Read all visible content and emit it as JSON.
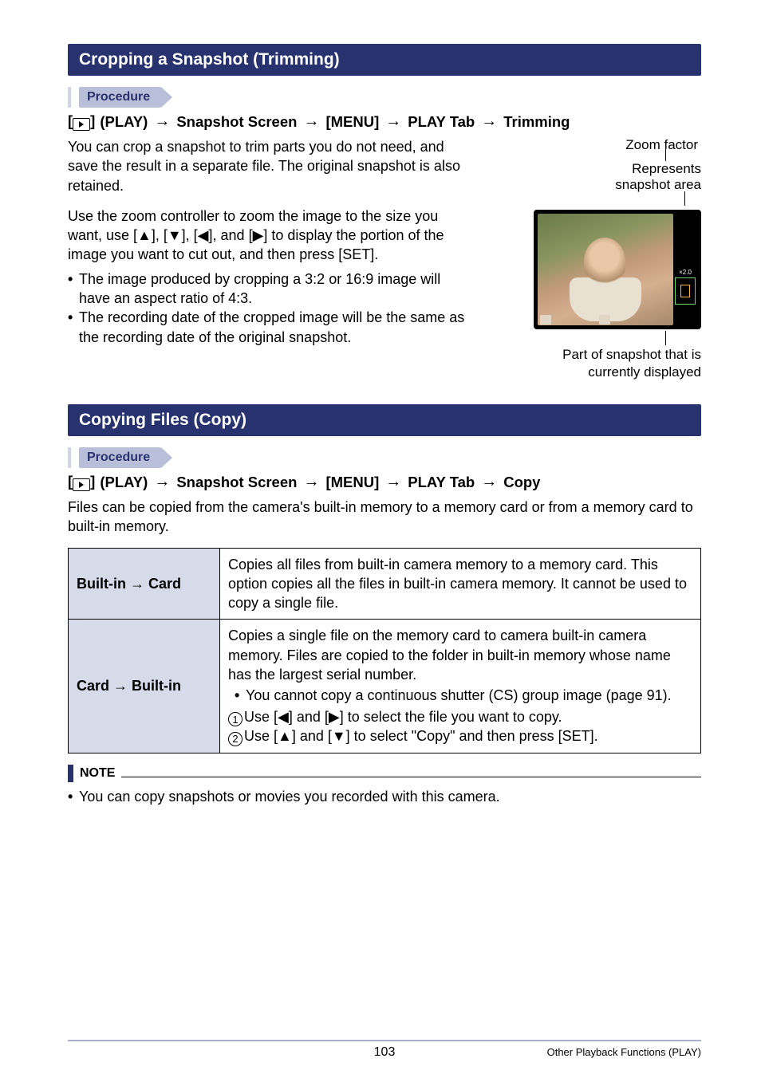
{
  "section1": {
    "title": "Cropping a Snapshot (Trimming)",
    "procedure_label": "Procedure",
    "breadcrumb": [
      "(PLAY)",
      "Snapshot Screen",
      "[MENU]",
      "PLAY Tab",
      "Trimming"
    ],
    "para1": "You can crop a snapshot to trim parts you do not need, and save the result in a separate file. The original snapshot is also retained.",
    "para2": "Use the zoom controller to zoom the image to the size you want, use [▲], [▼], [◀], and [▶] to display the portion of the image you want to cut out, and then press [SET].",
    "bullets": [
      "The image produced by cropping a 3:2 or 16:9 image will have an aspect ratio of 4:3.",
      "The recording date of the cropped image will be the same as the recording date of the original snapshot."
    ],
    "labels": {
      "zoom": "Zoom factor",
      "represents1": "Represents",
      "represents2": "snapshot area",
      "part1": "Part of snapshot that is",
      "part2": "currently displayed"
    }
  },
  "section2": {
    "title": "Copying Files (Copy)",
    "procedure_label": "Procedure",
    "breadcrumb": [
      "(PLAY)",
      "Snapshot Screen",
      "[MENU]",
      "PLAY Tab",
      "Copy"
    ],
    "para1": "Files can be copied from the camera's built-in memory to a memory card or from a memory card to built-in memory.",
    "rows": [
      {
        "label_left": "Built-in",
        "label_right": "Card",
        "desc": "Copies all files from built-in camera memory to a memory card. This option copies all the files in built-in camera memory. It cannot be used to copy a single file."
      },
      {
        "label_left": "Card",
        "label_right": "Built-in",
        "desc_intro": "Copies a single file on the memory card to camera built-in camera memory. Files are copied to the folder in built-in memory whose name has the largest serial number.",
        "bullet": "You cannot copy a continuous shutter (CS) group image (page 91).",
        "step1": "Use [◀] and [▶] to select the file you want to copy.",
        "step2": "Use [▲] and [▼] to select \"Copy\" and then press [SET]."
      }
    ]
  },
  "note": {
    "label": "NOTE",
    "text": "You can copy snapshots or movies you recorded with this camera."
  },
  "footer": {
    "page": "103",
    "section": "Other Playback Functions (PLAY)"
  }
}
